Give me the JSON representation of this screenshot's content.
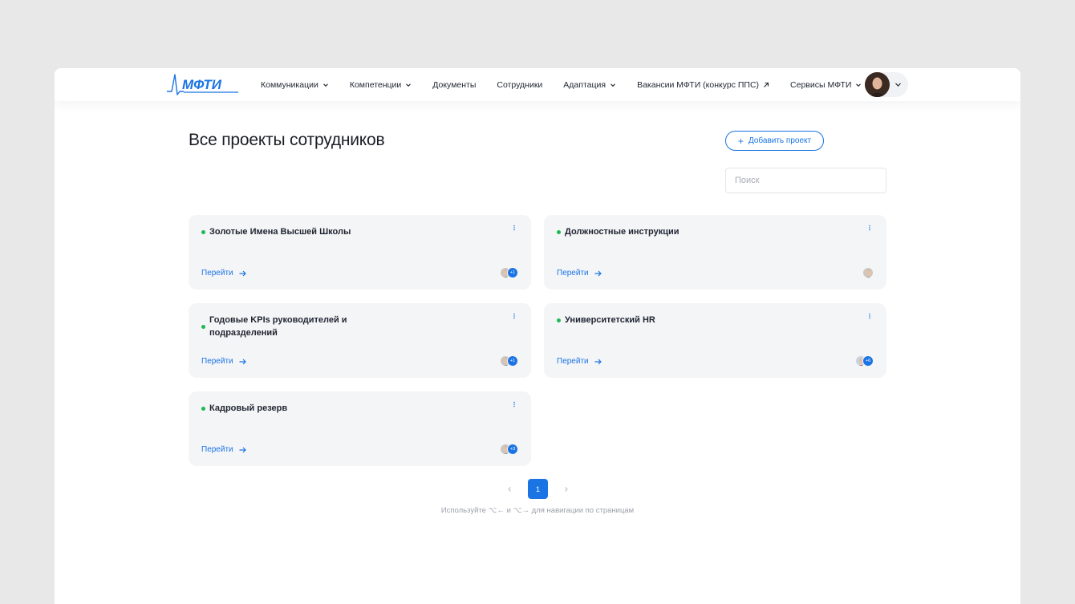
{
  "colors": {
    "accent": "#1b74e4",
    "status_active": "#1db954",
    "card_bg": "#f4f5f7"
  },
  "logo": {
    "text": "МФТИ"
  },
  "nav": [
    {
      "label": "Коммуникации",
      "icon": "chevron-down-icon"
    },
    {
      "label": "Компетенции",
      "icon": "chevron-down-icon"
    },
    {
      "label": "Документы"
    },
    {
      "label": "Сотрудники"
    },
    {
      "label": "Адаптация",
      "icon": "chevron-down-icon"
    },
    {
      "label": "Вакансии МФТИ (конкурс ППС)",
      "icon": "external-arrow-icon"
    },
    {
      "label": "Сервисы МФТИ",
      "icon": "chevron-down-icon"
    }
  ],
  "page": {
    "title": "Все проекты сотрудников",
    "add_button": "Добавить проект",
    "search_placeholder": "Поиск"
  },
  "projects": [
    {
      "title": "Золотые Имена Высшей Школы",
      "link": "Перейти",
      "extra_members": "+1"
    },
    {
      "title": "Должностные инструкции",
      "link": "Перейти",
      "extra_members": ""
    },
    {
      "title": "Годовые KPIs руководителей и подразделений",
      "link": "Перейти",
      "extra_members": "+1"
    },
    {
      "title": "Университетский HR",
      "link": "Перейти",
      "extra_members": "+6"
    },
    {
      "title": "Кадровый резерв",
      "link": "Перейти",
      "extra_members": "+3"
    }
  ],
  "pagination": {
    "current_page": "1",
    "hint": "Используйте ⌥← и ⌥→ для навигации по страницам"
  }
}
